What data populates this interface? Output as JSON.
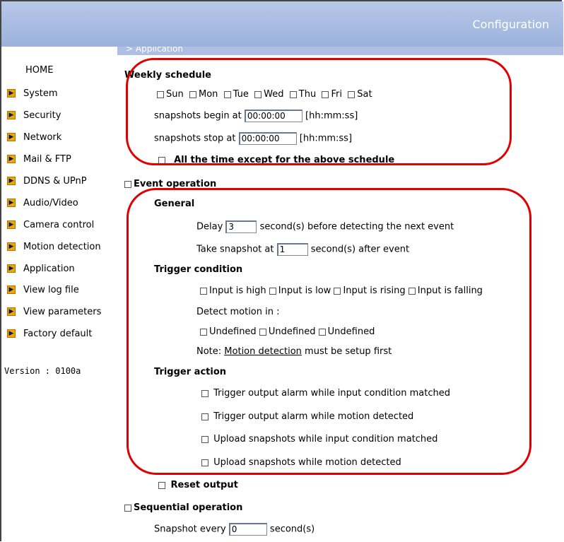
{
  "header": {
    "title": "Configuration"
  },
  "section": {
    "title": "> Application"
  },
  "sidebar": {
    "home": "HOME",
    "items": [
      {
        "label": "System"
      },
      {
        "label": "Security"
      },
      {
        "label": "Network"
      },
      {
        "label": "Mail & FTP"
      },
      {
        "label": "DDNS & UPnP"
      },
      {
        "label": "Audio/Video"
      },
      {
        "label": "Camera control"
      },
      {
        "label": "Motion detection"
      },
      {
        "label": "Application"
      },
      {
        "label": "View log file"
      },
      {
        "label": "View parameters"
      },
      {
        "label": "Factory default"
      }
    ],
    "version": "Version : 0100a"
  },
  "weekly": {
    "title": "Weekly schedule",
    "days": [
      "Sun",
      "Mon",
      "Tue",
      "Wed",
      "Thu",
      "Fri",
      "Sat"
    ],
    "begin_label": "snapshots begin at",
    "begin_value": "00:00:00",
    "stop_label": "snapshots stop at",
    "stop_value": "00:00:00",
    "format_hint": "[hh:mm:ss]",
    "except_label": "All the time except for the above schedule"
  },
  "event": {
    "title": "Event operation",
    "general": "General",
    "delay_label": "Delay",
    "delay_value": "3",
    "delay_suffix": "second(s) before detecting the next event",
    "snapshot_label": "Take snapshot at",
    "snapshot_value": "1",
    "snapshot_suffix": "second(s) after event",
    "trigger_condition": "Trigger condition",
    "inputs": [
      "Input is high",
      "Input is low",
      "Input is rising",
      "Input is falling"
    ],
    "detect_motion": "Detect motion in :",
    "motion_windows": [
      "Undefined",
      "Undefined",
      "Undefined"
    ],
    "note_prefix": "Note: ",
    "note_link": "Motion detection",
    "note_suffix": " must be setup first",
    "trigger_action": "Trigger action",
    "actions": [
      "Trigger output alarm while input condition matched",
      "Trigger output alarm while motion detected",
      "Upload snapshots while input condition matched",
      "Upload snapshots while motion detected"
    ],
    "reset_output": "Reset output"
  },
  "sequential": {
    "title": "Sequential operation",
    "label": "Snapshot every",
    "value": "0",
    "suffix": "second(s)"
  },
  "colors": {
    "header": "#aebfe3",
    "highlight": "#e00000",
    "menu_arrow": "#f0a800"
  }
}
